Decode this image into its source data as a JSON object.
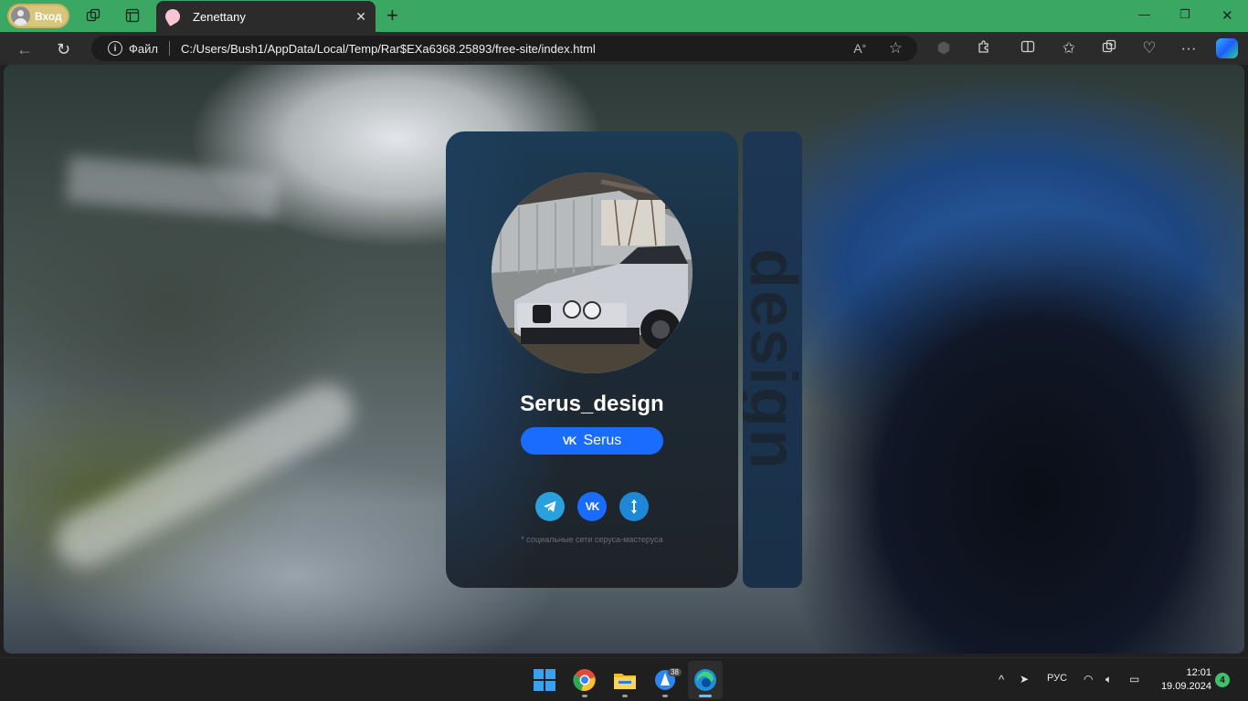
{
  "browser": {
    "profile_label": "Вход",
    "tab_title": "Zenettany",
    "address": {
      "scheme_label": "Файл",
      "url": "C:/Users/Bush1/AppData/Local/Temp/Rar$EXa6368.25893/free-site/index.html"
    }
  },
  "page": {
    "card": {
      "title": "Serus_design",
      "vk_button_glyph": "VK",
      "vk_button_label": "Serus",
      "social_links": [
        {
          "name": "telegram-icon",
          "color": "#2aa0dd"
        },
        {
          "name": "vk-icon",
          "color": "#1a6cff"
        },
        {
          "name": "transfer-icon",
          "color": "#1e88d6"
        }
      ],
      "footnote": "* социальные сети серуса-мастеруса"
    },
    "side_panel_text": "design"
  },
  "taskbar": {
    "telegram_badge": "38",
    "language": "РУС",
    "time": "12:01",
    "date": "19.09.2024",
    "notifications": "4"
  }
}
